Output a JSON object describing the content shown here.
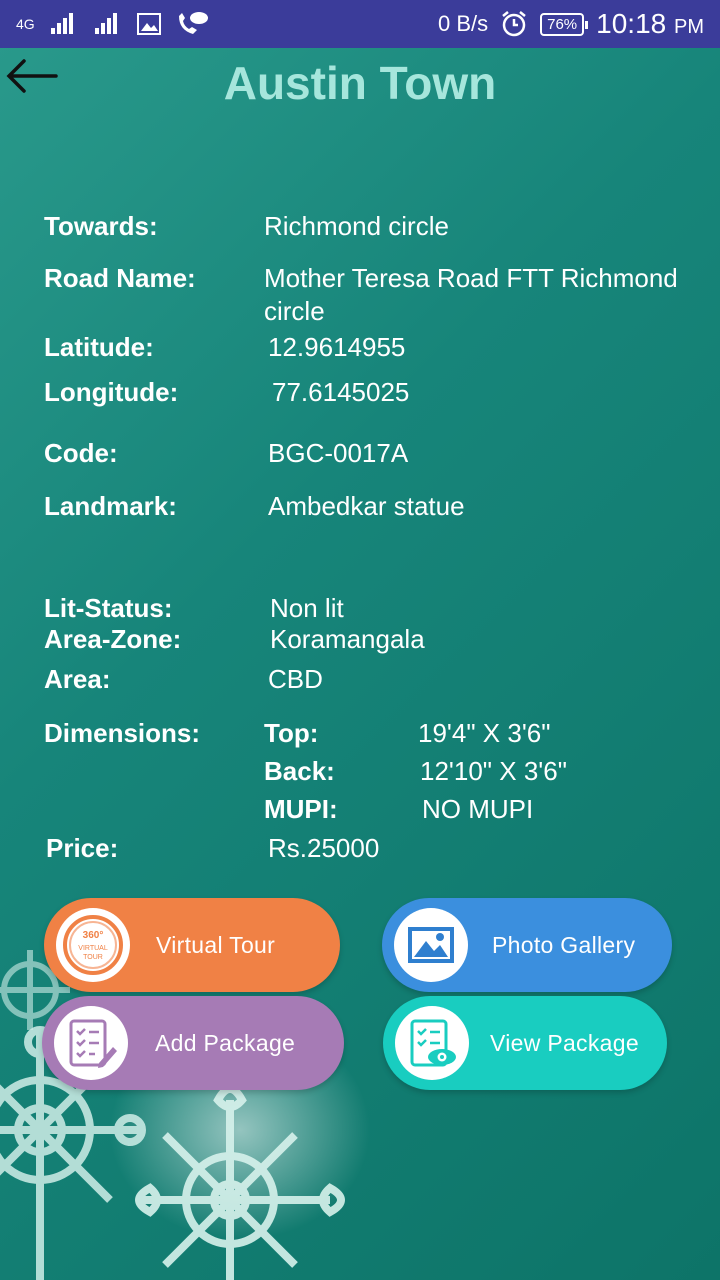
{
  "status_bar": {
    "network": "4G",
    "speed": "0 B/s",
    "battery": "76%",
    "time": "10:18",
    "ampm": "PM"
  },
  "header": {
    "title": "Austin Town"
  },
  "details": {
    "towards_label": "Towards:",
    "towards_value": "Richmond circle",
    "road_label": "Road Name:",
    "road_value_line1": "Mother Teresa Road FTT Richmond",
    "road_value_line2": "circle",
    "latitude_label": "Latitude:",
    "latitude_value": "12.9614955",
    "longitude_label": "Longitude:",
    "longitude_value": "77.6145025",
    "code_label": "Code:",
    "code_value": "BGC-0017A",
    "landmark_label": "Landmark:",
    "landmark_value": "Ambedkar statue",
    "lit_label": "Lit-Status:",
    "lit_value": "Non lit",
    "zone_label": "Area-Zone:",
    "zone_value": "Koramangala",
    "area_label": "Area:",
    "area_value": "CBD",
    "dimensions_label": "Dimensions:",
    "top_label": "Top:",
    "top_value": "19'4\" X 3'6\"",
    "back_label": "Back:",
    "back_value": "12'10\" X 3'6\"",
    "mupi_label": "MUPI:",
    "mupi_value": "NO MUPI",
    "price_label": "Price:",
    "price_value": "Rs.25000"
  },
  "buttons": {
    "virtual_tour": "Virtual Tour",
    "photo_gallery": "Photo Gallery",
    "add_package": "Add Package",
    "view_package": "View Package",
    "tour_icon_text1": "360°",
    "tour_icon_text2": "VIRTUAL",
    "tour_icon_text3": "TOUR"
  },
  "colors": {
    "status_bar": "#3b3c9a",
    "title": "#a6e6dc",
    "virtual_tour": "#f08145",
    "photo_gallery": "#3b8fde",
    "add_package": "#a67bb5",
    "view_package": "#19cdc0"
  }
}
